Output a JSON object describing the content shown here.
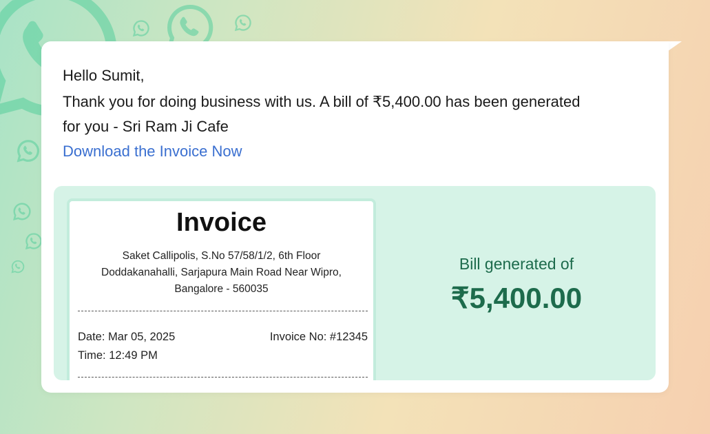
{
  "message": {
    "greeting": "Hello Sumit,",
    "body": "Thank you for doing business with us. A bill of ₹5,400.00 has been generated for you - Sri Ram Ji Cafe",
    "link_text": "Download the Invoice Now"
  },
  "invoice": {
    "title": "Invoice",
    "address": "Saket Callipolis, S.No 57/58/1/2, 6th Floor Doddakanahalli, Sarjapura Main Road Near Wipro, Bangalore - 560035",
    "date": "Date: Mar 05, 2025",
    "invoice_no": "Invoice No: #12345",
    "time": "Time: 12:49 PM"
  },
  "bill": {
    "label": "Bill generated of",
    "amount": "₹5,400.00"
  },
  "colors": {
    "link": "#3a6fd0",
    "accent_green": "#1d6b4c",
    "panel_bg": "#d6f3e7",
    "whatsapp_icon": "#57cf9d"
  },
  "icons": [
    "whatsapp-icon"
  ]
}
